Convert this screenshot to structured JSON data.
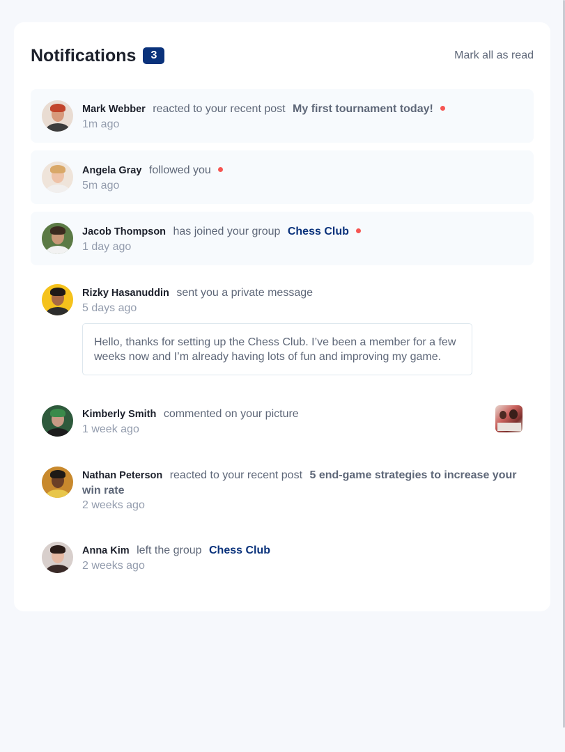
{
  "header": {
    "title": "Notifications",
    "count": "3",
    "mark_all": "Mark all as read"
  },
  "notifications": [
    {
      "name": "Mark Webber",
      "action": "reacted to your recent post",
      "post": "My first tournament today!",
      "time": "1m ago",
      "unread": true
    },
    {
      "name": "Angela Gray",
      "action": "followed you",
      "time": "5m ago",
      "unread": true
    },
    {
      "name": "Jacob Thompson",
      "action": "has joined your group",
      "group": "Chess Club",
      "time": "1 day ago",
      "unread": true
    },
    {
      "name": "Rizky Hasanuddin",
      "action": "sent you a private message",
      "time": "5 days ago",
      "message": "Hello, thanks for setting up the Chess Club. I’ve been a member for a few weeks now and I’m already having lots of fun and improving my game.",
      "unread": false
    },
    {
      "name": "Kimberly Smith",
      "action": "commented on your picture",
      "time": "1 week ago",
      "unread": false
    },
    {
      "name": "Nathan Peterson",
      "action": "reacted to your recent post",
      "post": "5 end-game strategies to increase your win rate",
      "time": "2 weeks ago",
      "unread": false
    },
    {
      "name": "Anna Kim",
      "action": "left the group",
      "group": "Chess Club",
      "time": "2 weeks ago",
      "unread": false
    }
  ],
  "colors": {
    "badge": "#0a327b",
    "unread_dot": "#f65552",
    "unread_background": "#f7fafd",
    "group_link": "#0a327b"
  }
}
